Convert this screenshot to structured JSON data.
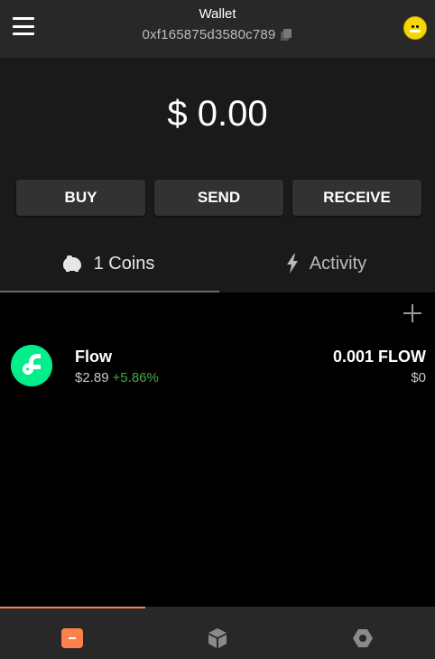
{
  "header": {
    "title": "Wallet",
    "address": "0xf165875d3580c789"
  },
  "balance": "$ 0.00",
  "actions": {
    "buy": "BUY",
    "send": "SEND",
    "receive": "RECEIVE"
  },
  "tabs": [
    {
      "label": "1 Coins",
      "icon": "piggy-bank-icon",
      "active": true
    },
    {
      "label": "Activity",
      "icon": "lightning-bolt-icon",
      "active": false
    }
  ],
  "coins": [
    {
      "name": "Flow",
      "price": "$2.89",
      "change": "+5.86%",
      "amount": "0.001 FLOW",
      "value": "$0",
      "logo_color": "#00ef8b"
    }
  ],
  "bottom_nav": [
    {
      "icon": "wallet-icon",
      "active": true
    },
    {
      "icon": "cube-icon",
      "active": false
    },
    {
      "icon": "settings-hexagon-icon",
      "active": false
    }
  ],
  "colors": {
    "accent": "#fc814a",
    "positive_change": "#3fae3f",
    "flow_green": "#00ef8b",
    "header_bg": "#282828",
    "panel_bg": "#1a1a1a",
    "button_bg": "#323232"
  }
}
